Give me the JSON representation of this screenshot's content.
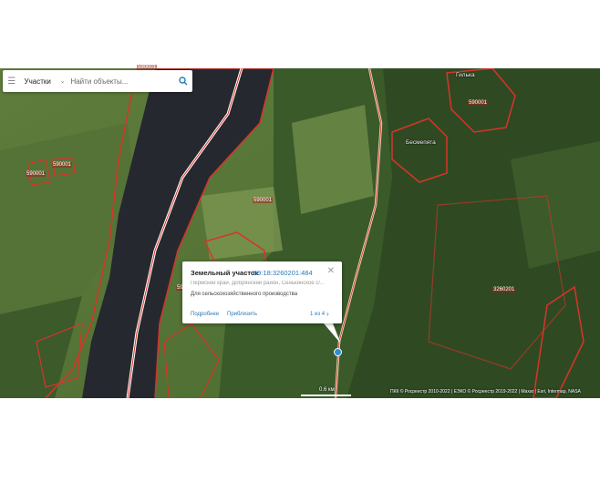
{
  "search": {
    "layer_label": "Участки",
    "placeholder": "Найти объекты..."
  },
  "map": {
    "place_labels": [
      "Гилька",
      "Бесмепята"
    ],
    "parcel_labels": [
      "590001",
      "590001",
      "590001",
      "590001",
      "590001",
      "590001",
      "3260201"
    ]
  },
  "popup": {
    "title": "Земельный участок",
    "cadastral_id": "59:18:3260201:484",
    "address": "Пермский край, Добрянский район, Сенькинское с/...",
    "usage": "Для сельскохозяйственного производства",
    "more_link": "Подробнее",
    "zoom_link": "Приблизить",
    "pagination": "1 из 4"
  },
  "scale": {
    "label": "0.6 км"
  },
  "attribution": "ПКК © Росреестр 2010-2022 | ЕЭКО © Росреестр 2019-2022 | Maxar | Esri, Intermap, NASA",
  "colors": {
    "parcel_border": "#d8342a",
    "water": "#26282f",
    "forest_dark": "#2f4a22",
    "field_light": "#6b8a45",
    "road": "#e9d9b8",
    "link_blue": "#2a7ab8"
  }
}
